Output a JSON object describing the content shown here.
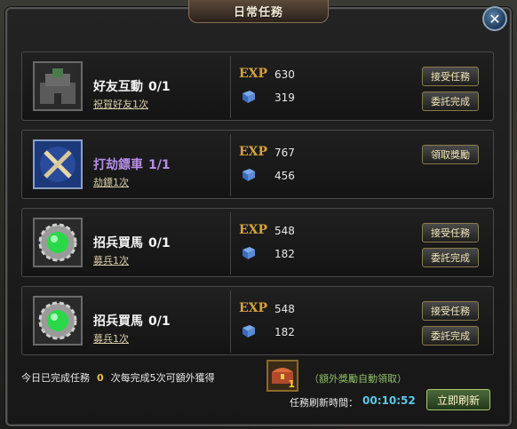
{
  "window": {
    "title": "日常任務"
  },
  "quests": [
    {
      "name": "好友互動",
      "progress": "0/1",
      "sub": "祝賀好友1次",
      "exp_label": "EXP",
      "exp": "630",
      "reward2": "319",
      "buttons": [
        "接受任務",
        "委託完成"
      ],
      "icon": "fortress-icon"
    },
    {
      "name": "打劫鏢車",
      "progress": "1/1",
      "sub": "劫鏢1次",
      "exp_label": "EXP",
      "exp": "767",
      "reward2": "456",
      "buttons": [
        "領取獎勵"
      ],
      "icon": "crossed-swords-icon"
    },
    {
      "name": "招兵買馬",
      "progress": "0/1",
      "sub": "募兵1次",
      "exp_label": "EXP",
      "exp": "548",
      "reward2": "182",
      "buttons": [
        "接受任務",
        "委託完成"
      ],
      "icon": "green-orb-gear-icon"
    },
    {
      "name": "招兵買馬",
      "progress": "0/1",
      "sub": "募兵1次",
      "exp_label": "EXP",
      "exp": "548",
      "reward2": "182",
      "buttons": [
        "接受任務",
        "委託完成"
      ],
      "icon": "green-orb-gear-icon"
    }
  ],
  "footer": {
    "completed_prefix": "今日已完成任務",
    "completed_count": "0",
    "bonus_text": "次每完成5次可額外獲得",
    "chest_count": "1",
    "extra_note": "（額外獎勵自動領取）",
    "refresh_label": "任務刷新時間：",
    "refresh_time": "00:10:52",
    "refresh_button": "立即刷新"
  },
  "colors": {
    "exp": "#d6a23a",
    "purple_name": "#b78ee8",
    "timer": "#5cc8e8"
  }
}
